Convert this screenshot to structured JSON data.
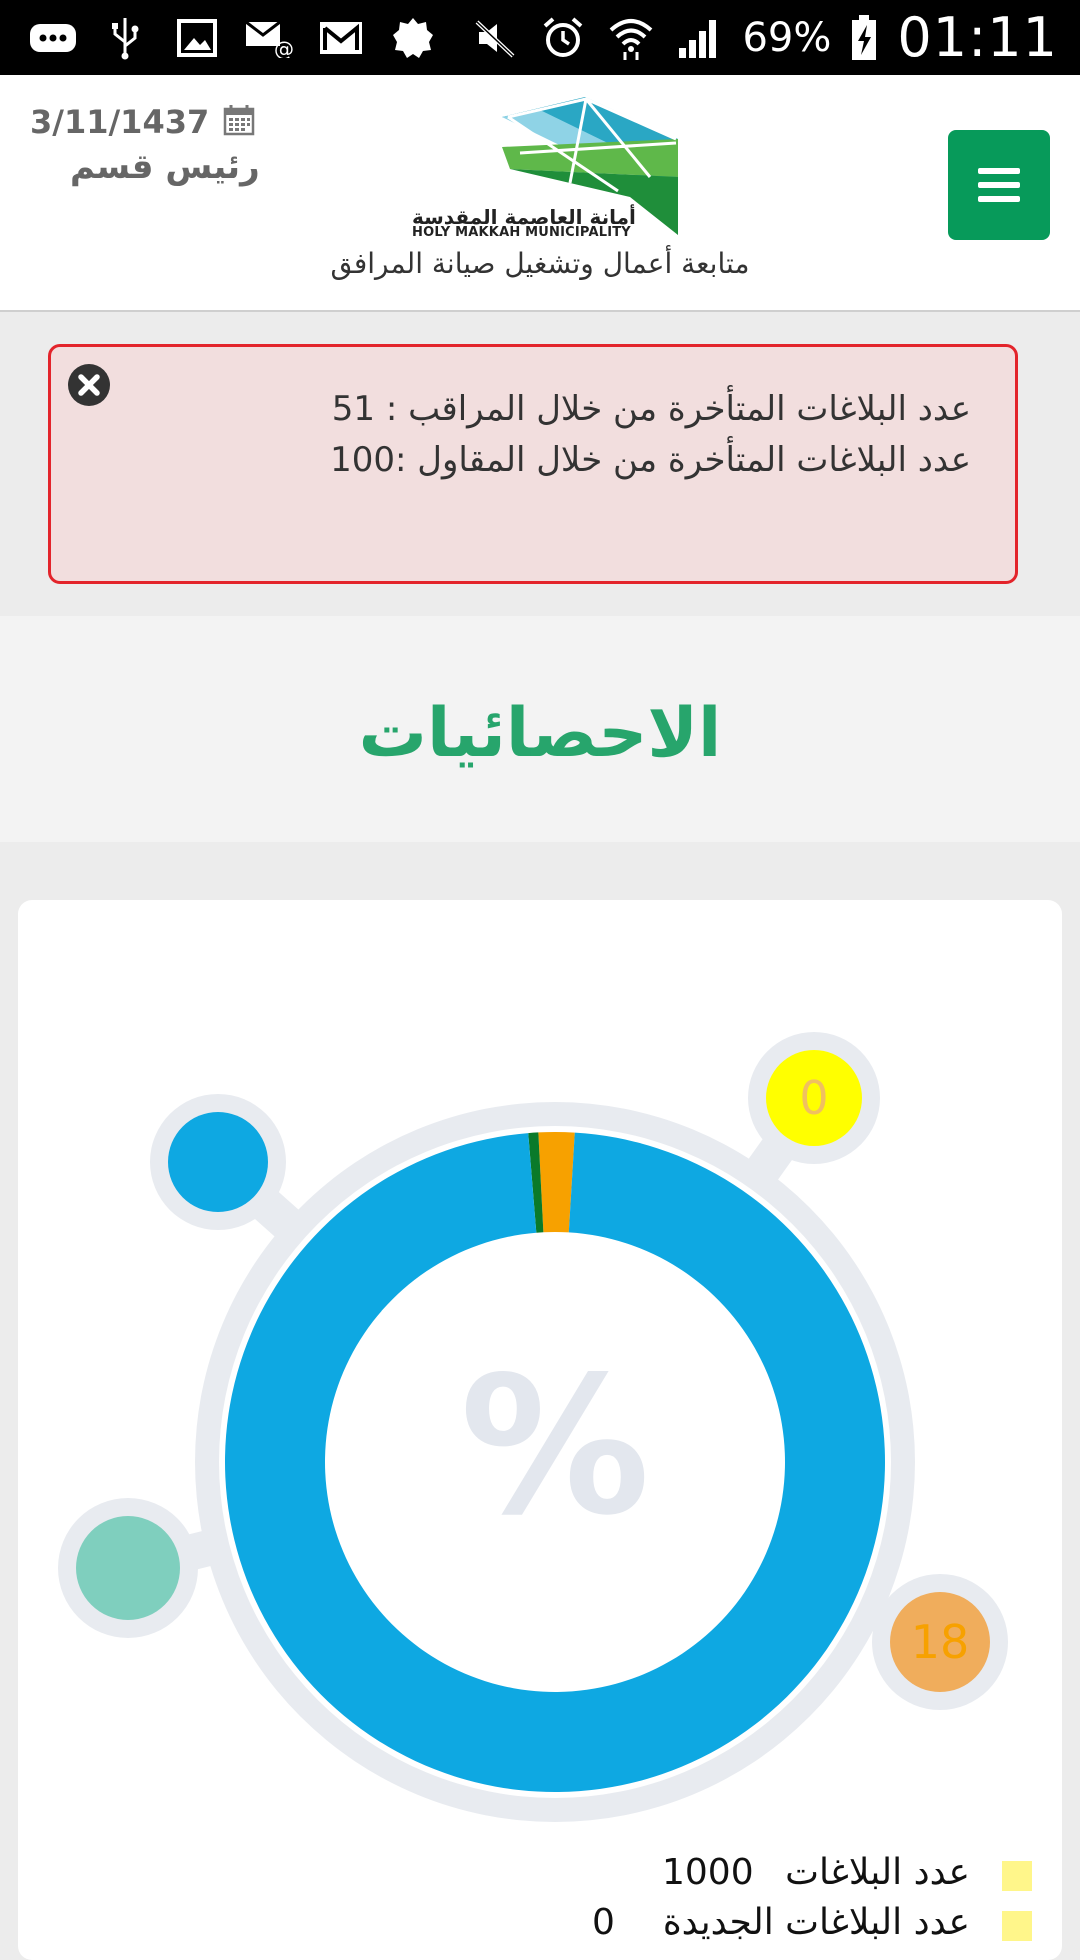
{
  "status_bar": {
    "battery": "69%",
    "clock": "01:11",
    "icons": [
      "bbm-icon",
      "usb-icon",
      "gallery-icon",
      "email-icon",
      "gmail-icon",
      "app-icon",
      "mute-icon",
      "alarm-icon",
      "wifi-icon",
      "signal-icon",
      "battery-charging-icon"
    ]
  },
  "header": {
    "date": "3/11/1437",
    "role": "رئيس قسم",
    "logo_ar": "أمانة العاصمة المقدسة",
    "logo_en": "HOLY MAKKAH MUNICIPALITY",
    "subtitle": "متابعة أعمال وتشغيل صيانة المرافق",
    "menu_icon": "hamburger-icon",
    "brand_color": "#079a5a"
  },
  "alert": {
    "line1": "عدد البلاغات المتأخرة من خلال المراقب : 51",
    "line2": "عدد البلاغات المتأخرة من خلال المقاول :100",
    "close_icon": "close-circle-icon",
    "background": "#f2dede",
    "border": "#e3242b"
  },
  "section": {
    "title": "الاحصائيات",
    "color": "#27a56c"
  },
  "chart_data": {
    "type": "pie",
    "slices": [
      {
        "value": 1000,
        "color": "#0ea8e2"
      },
      {
        "value": 18,
        "color": "#f7a100"
      },
      {
        "value": 5,
        "color": "#0a7a2a"
      }
    ],
    "center_symbol": "%",
    "bubbles": [
      {
        "value": "0",
        "color": "#ffff00",
        "text_color": "#f0c060"
      },
      {
        "value": "18",
        "color": "#f0ad5c",
        "text_color": "#f7a100"
      },
      {
        "value": "",
        "color": "#0ea8e2",
        "text_color": "#ffffff"
      },
      {
        "value": "",
        "color": "#7fcfbe",
        "text_color": "#ffffff"
      }
    ],
    "legend": [
      {
        "label": "عدد البلاغات",
        "value": "1000",
        "color": "#fff68a"
      },
      {
        "label": "عدد البلاغات الجديدة",
        "value": "0",
        "color": "#fff68a"
      }
    ]
  }
}
